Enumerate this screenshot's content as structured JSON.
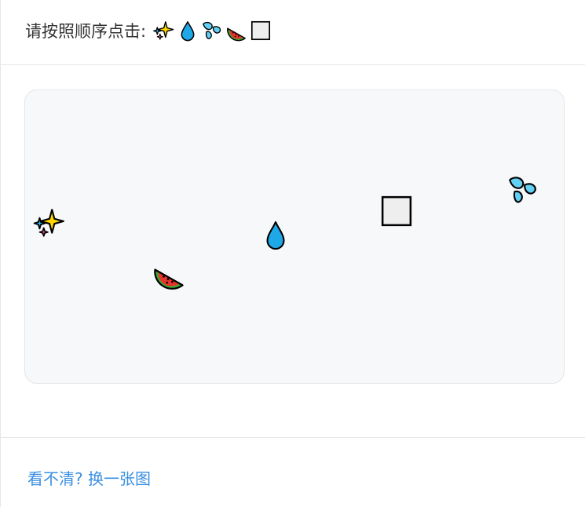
{
  "prompt": {
    "text": "请按照顺序点击:",
    "sequence": [
      "sparkles-icon",
      "droplet-icon",
      "sweat-droplets-icon",
      "watermelon-icon",
      "white-square-icon"
    ]
  },
  "targets": [
    {
      "icon": "sparkles-icon"
    },
    {
      "icon": "droplet-icon"
    },
    {
      "icon": "white-square-icon"
    },
    {
      "icon": "sweat-droplets-icon"
    },
    {
      "icon": "watermelon-icon"
    }
  ],
  "footer": {
    "refresh_label": "看不清? 换一张图"
  },
  "colors": {
    "link": "#3b8fe0",
    "panel_bg": "#f7f8fa",
    "droplet": "#1fa8e8",
    "sparkle": "#ffd700",
    "watermelon_red": "#e8332c",
    "watermelon_green": "#3aa832"
  }
}
